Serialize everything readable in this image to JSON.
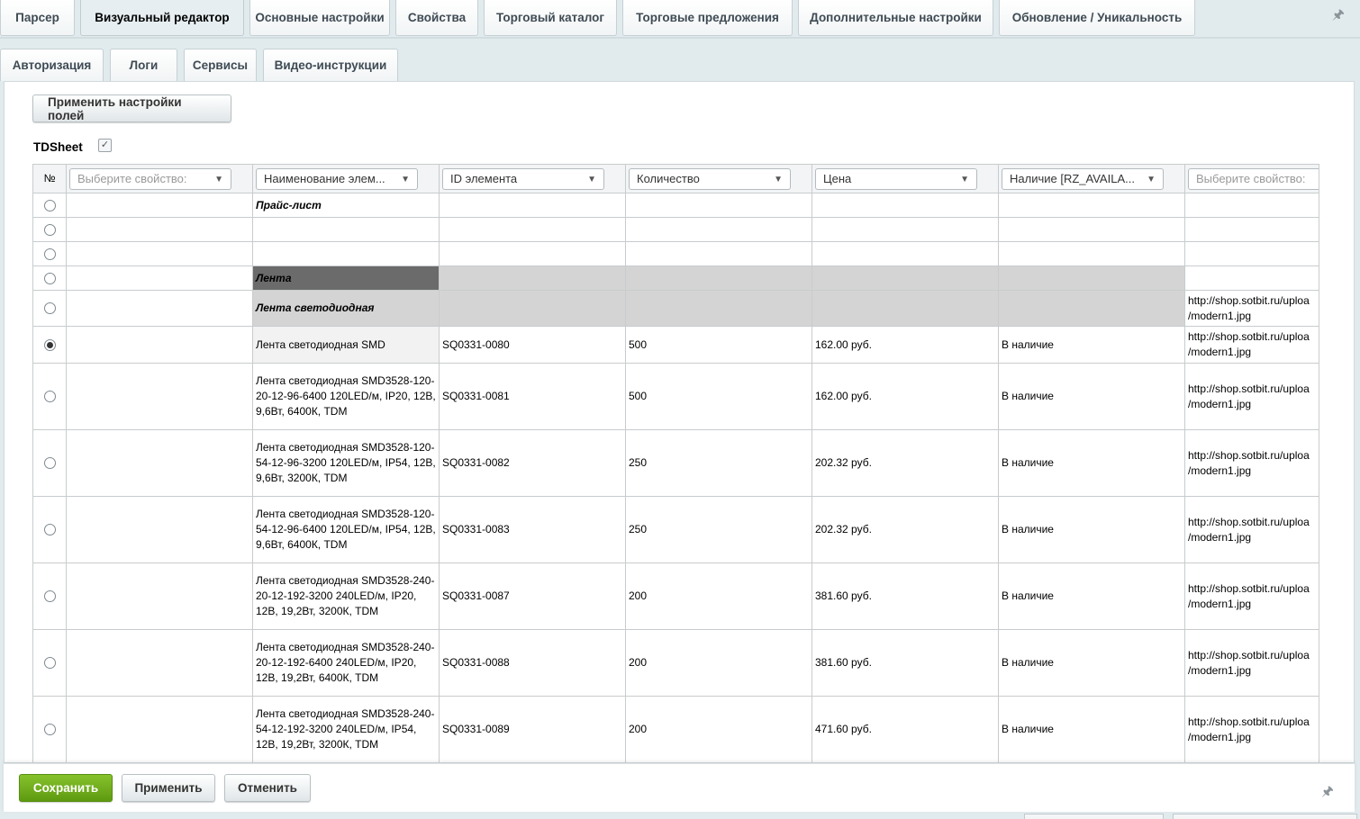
{
  "tabs_row1": [
    {
      "label": "Парсер",
      "active": false
    },
    {
      "label": "Визуальный редактор",
      "active": true
    },
    {
      "label": "Основные настройки",
      "active": false
    },
    {
      "label": "Свойства",
      "active": false
    },
    {
      "label": "Торговый каталог",
      "active": false
    },
    {
      "label": "Торговые предложения",
      "active": false
    },
    {
      "label": "Дополнительные настройки",
      "active": false
    },
    {
      "label": "Обновление / Уникальность",
      "active": false
    }
  ],
  "tabs_row2": [
    {
      "label": "Авторизация"
    },
    {
      "label": "Логи"
    },
    {
      "label": "Сервисы"
    },
    {
      "label": "Видео-инструкции"
    }
  ],
  "apply_fields_button": "Применить настройки полей",
  "sheet": {
    "name": "TDSheet",
    "checked": true,
    "check_glyph": "✓"
  },
  "pin_icon": "🖈",
  "table": {
    "num_header": "№",
    "columns": [
      {
        "value": "Выберите свойство:",
        "placeholder": true
      },
      {
        "value": "Наименование элем...",
        "placeholder": false
      },
      {
        "value": "ID элемента",
        "placeholder": false
      },
      {
        "value": "Количество",
        "placeholder": false
      },
      {
        "value": "Цена",
        "placeholder": false
      },
      {
        "value": "Наличие [RZ_AVAILA...",
        "placeholder": false
      },
      {
        "value": "Выберите свойство:",
        "placeholder": true
      }
    ],
    "arrow_glyph": "▼",
    "rows": [
      {
        "radio": false,
        "name": "Прайс-лист",
        "style": "title"
      },
      {
        "radio": false,
        "name": ""
      },
      {
        "radio": false,
        "name": ""
      },
      {
        "radio": false,
        "name": "Лента",
        "style": "section"
      },
      {
        "radio": false,
        "name": "Лента светодиодная",
        "style": "subsection",
        "url": "http://shop.sotbit.ru/uploa /modern1.jpg"
      },
      {
        "radio": true,
        "name": "Лента светодиодная SMD",
        "id": "SQ0331-0080",
        "qty": "500",
        "price": "162.00 руб.",
        "avail": "В наличие",
        "url": "http://shop.sotbit.ru/uploa /modern1.jpg"
      },
      {
        "radio": false,
        "name": "Лента светодиодная SMD3528-120-20-12-96-6400 120LED/м, IP20, 12В, 9,6Вт, 6400К, TDM",
        "id": "SQ0331-0081",
        "qty": "500",
        "price": "162.00 руб.",
        "avail": "В наличие",
        "url": "http://shop.sotbit.ru/uploa /modern1.jpg"
      },
      {
        "radio": false,
        "name": "Лента светодиодная SMD3528-120-54-12-96-3200 120LED/м, IP54, 12В, 9,6Вт, 3200К, TDM",
        "id": "SQ0331-0082",
        "qty": "250",
        "price": "202.32 руб.",
        "avail": "В наличие",
        "url": "http://shop.sotbit.ru/uploa /modern1.jpg"
      },
      {
        "radio": false,
        "name": "Лента светодиодная SMD3528-120-54-12-96-6400 120LED/м, IP54, 12В, 9,6Вт, 6400К, TDM",
        "id": "SQ0331-0083",
        "qty": "250",
        "price": "202.32 руб.",
        "avail": "В наличие",
        "url": "http://shop.sotbit.ru/uploa /modern1.jpg"
      },
      {
        "radio": false,
        "name": "Лента светодиодная SMD3528-240-20-12-192-3200 240LED/м, IP20, 12В, 19,2Вт, 3200К, TDM",
        "id": "SQ0331-0087",
        "qty": "200",
        "price": "381.60 руб.",
        "avail": "В наличие",
        "url": "http://shop.sotbit.ru/uploa /modern1.jpg"
      },
      {
        "radio": false,
        "name": "Лента светодиодная SMD3528-240-20-12-192-6400 240LED/м, IP20, 12В, 19,2Вт, 6400К, TDM",
        "id": "SQ0331-0088",
        "qty": "200",
        "price": "381.60 руб.",
        "avail": "В наличие",
        "url": "http://shop.sotbit.ru/uploa /modern1.jpg"
      },
      {
        "radio": false,
        "name": "Лента светодиодная SMD3528-240-54-12-192-3200 240LED/м, IP54, 12В, 19,2Вт, 3200К, TDM",
        "id": "SQ0331-0089",
        "qty": "200",
        "price": "471.60 руб.",
        "avail": "В наличие",
        "url": "http://shop.sotbit.ru/uploa /modern1.jpg"
      }
    ]
  },
  "footer": {
    "save": "Сохранить",
    "apply": "Применить",
    "cancel": "Отменить"
  },
  "colors": {
    "save_green": "#6aa81b",
    "section_dark": "#6b6b6b",
    "section_gray": "#d4d4d4"
  }
}
